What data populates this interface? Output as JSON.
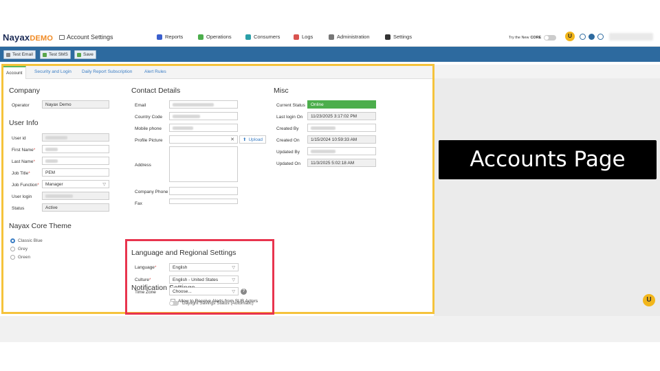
{
  "brand": {
    "name": "Nayax",
    "demo": "DEMO",
    "page_title": "Account Settings"
  },
  "nav": [
    {
      "label": "Reports",
      "color": "#3a5fcd"
    },
    {
      "label": "Operations",
      "color": "#4cae4c"
    },
    {
      "label": "Consumers",
      "color": "#2a9fa8"
    },
    {
      "label": "Logs",
      "color": "#d9534f"
    },
    {
      "label": "Administration",
      "color": "#777777"
    },
    {
      "label": "Settings",
      "color": "#333333"
    }
  ],
  "header": {
    "try_core": "Try the New",
    "core": "CORE",
    "user_badge": "U"
  },
  "toolbar": {
    "test_email": "Test Email",
    "test_sms": "Test SMS",
    "save": "Save"
  },
  "tabs": [
    "Account",
    "Security and Login",
    "Daily Report Subscription",
    "Alert Rules"
  ],
  "company": {
    "heading": "Company",
    "operator_label": "Operator",
    "operator_value": "Nayax Demo"
  },
  "user_info": {
    "heading": "User Info",
    "user_id_label": "User id",
    "first_name_label": "First Name",
    "last_name_label": "Last Name",
    "job_title_label": "Job Title",
    "job_title_value": "PEM",
    "job_function_label": "Job Function",
    "job_function_value": "Manager",
    "user_login_label": "User login",
    "status_label": "Status",
    "status_value": "Active"
  },
  "theme": {
    "heading": "Nayax Core Theme",
    "options": [
      "Classic Blue",
      "Grey",
      "Green"
    ],
    "selected": "Classic Blue"
  },
  "contact": {
    "heading": "Contact Details",
    "email_label": "Email",
    "country_code_label": "Country Code",
    "mobile_label": "Mobile phone",
    "profile_picture_label": "Profile Picture",
    "upload_label": "Upload",
    "address_label": "Address",
    "company_phone_label": "Company Phone",
    "fax_label": "Fax"
  },
  "misc": {
    "heading": "Misc",
    "current_status_label": "Current Status",
    "current_status_value": "Online",
    "last_login_label": "Last login On",
    "last_login_value": "11/23/2025 3:17:02 PM",
    "created_by_label": "Created By",
    "created_on_label": "Created On",
    "created_on_value": "1/15/2024 10:59:33 AM",
    "updated_by_label": "Updated By",
    "updated_on_label": "Updated On",
    "updated_on_value": "11/3/2025 5:02:18 AM"
  },
  "regional": {
    "heading": "Language and Regional Settings",
    "language_label": "Language",
    "language_value": "English",
    "culture_label": "Culture",
    "culture_value": "English - United States",
    "timezone_label": "Time Zone",
    "timezone_value": "Choose...",
    "dst_label": "Daylight Savings Status (Automatic)"
  },
  "notification": {
    "heading": "Notification Settings",
    "sub_actors_label": "Allow to Receive Alerts from SUB Actors"
  },
  "callout": {
    "text": "Accounts Page"
  }
}
